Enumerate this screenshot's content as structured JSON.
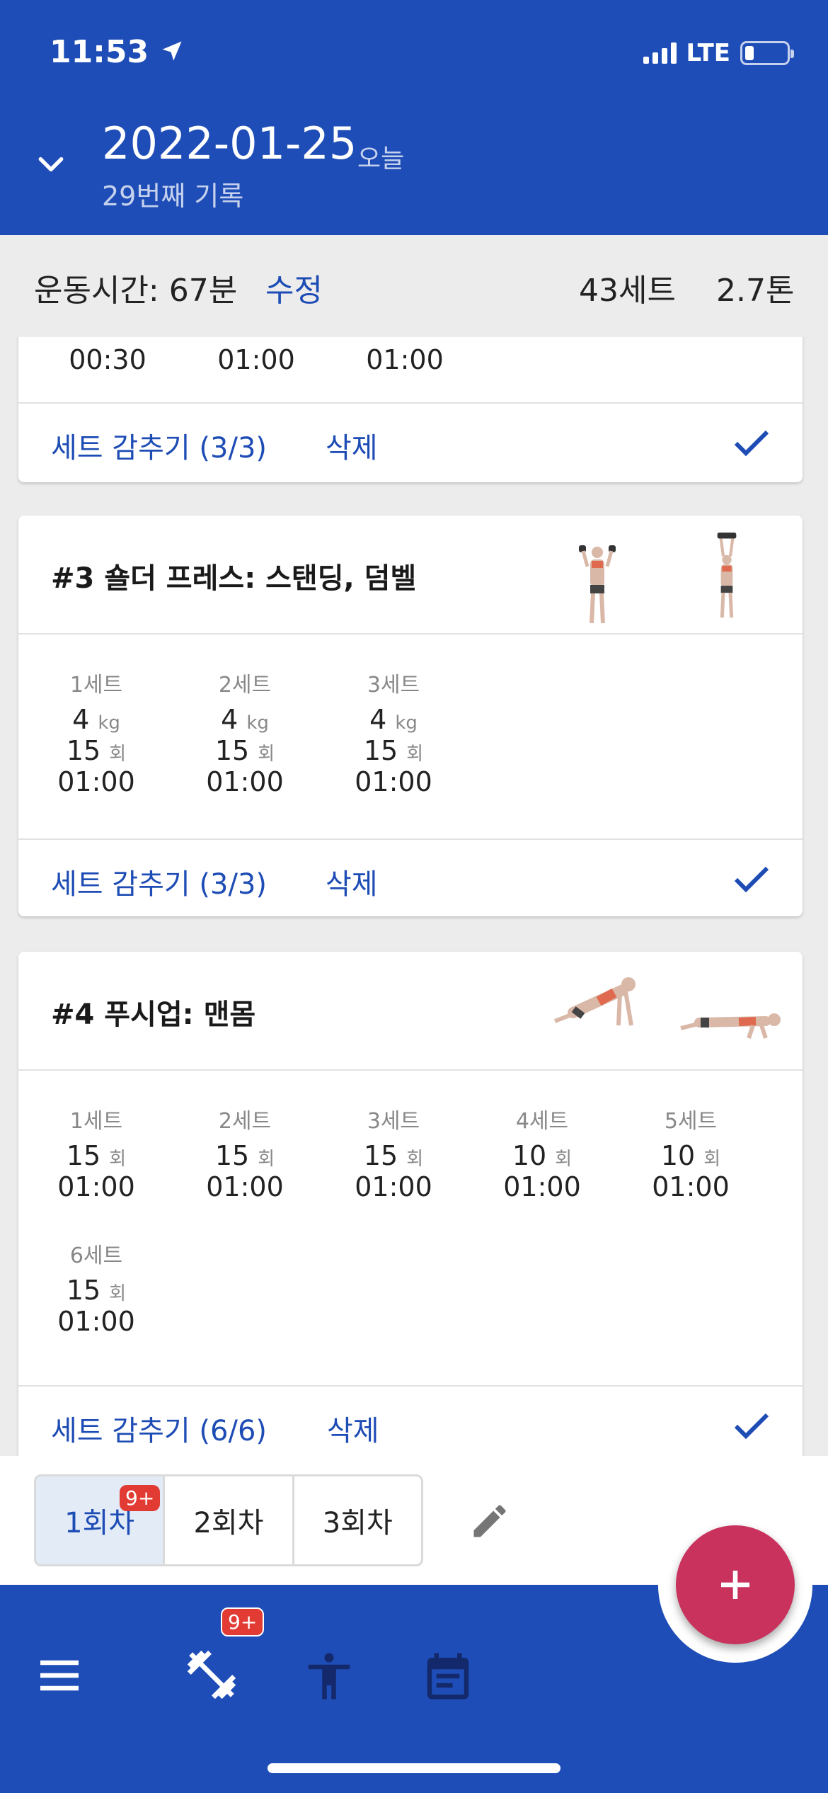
{
  "status_bar": {
    "time": "11:53",
    "network": "LTE"
  },
  "header": {
    "date": "2022-01-25",
    "today_label": "오늘",
    "record_count": "29번째 기록"
  },
  "summary": {
    "time_label": "운동시간: 67분",
    "edit_label": "수정",
    "sets": "43세트",
    "tonnage": "2.7톤"
  },
  "card_prev": {
    "times": [
      "00:30",
      "01:00",
      "01:00"
    ],
    "hide_label": "세트 감추기 (3/3)",
    "delete_label": "삭제"
  },
  "card3": {
    "title": "#3 숄더 프레스: 스탠딩, 덤벨",
    "sets": [
      {
        "label": "1세트",
        "weight": "4",
        "weight_unit": "kg",
        "reps": "15",
        "reps_unit": "회",
        "time": "01:00"
      },
      {
        "label": "2세트",
        "weight": "4",
        "weight_unit": "kg",
        "reps": "15",
        "reps_unit": "회",
        "time": "01:00"
      },
      {
        "label": "3세트",
        "weight": "4",
        "weight_unit": "kg",
        "reps": "15",
        "reps_unit": "회",
        "time": "01:00"
      }
    ],
    "hide_label": "세트 감추기 (3/3)",
    "delete_label": "삭제"
  },
  "card4": {
    "title": "#4 푸시업: 맨몸",
    "sets": [
      {
        "label": "1세트",
        "reps": "15",
        "reps_unit": "회",
        "time": "01:00"
      },
      {
        "label": "2세트",
        "reps": "15",
        "reps_unit": "회",
        "time": "01:00"
      },
      {
        "label": "3세트",
        "reps": "15",
        "reps_unit": "회",
        "time": "01:00"
      },
      {
        "label": "4세트",
        "reps": "10",
        "reps_unit": "회",
        "time": "01:00"
      },
      {
        "label": "5세트",
        "reps": "10",
        "reps_unit": "회",
        "time": "01:00"
      },
      {
        "label": "6세트",
        "reps": "15",
        "reps_unit": "회",
        "time": "01:00"
      }
    ],
    "hide_label": "세트 감추기 (6/6)",
    "delete_label": "삭제"
  },
  "session_tabs": [
    {
      "label": "1회차",
      "badge": "9+"
    },
    {
      "label": "2회차"
    },
    {
      "label": "3회차"
    }
  ],
  "nav": {
    "workout_badge": "9+"
  },
  "colors": {
    "primary": "#1f4db7",
    "link": "#1e4cb5",
    "fab": "#c8325d",
    "badge": "#e23b33"
  }
}
